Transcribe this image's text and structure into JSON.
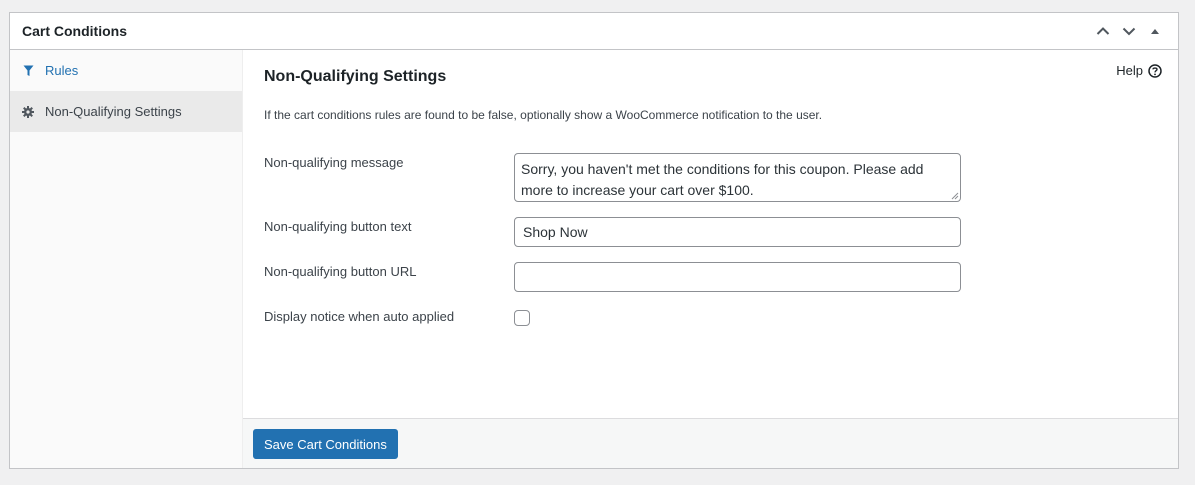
{
  "metabox": {
    "title": "Cart Conditions",
    "actions": [
      {
        "name": "move-up-button",
        "icon": "chevron-up-icon"
      },
      {
        "name": "move-down-button",
        "icon": "chevron-down-icon"
      },
      {
        "name": "toggle-panel-button",
        "icon": "triangle-up-icon"
      }
    ]
  },
  "tabs": [
    {
      "label": "Rules",
      "icon": "filter-icon",
      "active": false
    },
    {
      "label": "Non-Qualifying Settings",
      "icon": "gear-icon",
      "active": true
    }
  ],
  "panel": {
    "title": "Non-Qualifying Settings",
    "help_label": "Help",
    "description": "If the cart conditions rules are found to be false, optionally show a WooCommerce notification to the user.",
    "fields": {
      "message": {
        "label": "Non-qualifying message",
        "value": "Sorry, you haven't met the conditions for this coupon. Please add more to increase your cart over $100."
      },
      "button_text": {
        "label": "Non-qualifying button text",
        "value": "Shop Now"
      },
      "button_url": {
        "label": "Non-qualifying button URL",
        "value": ""
      },
      "display_notice": {
        "label": "Display notice when auto applied",
        "checked": false
      }
    }
  },
  "footer": {
    "save_label": "Save Cart Conditions"
  },
  "colors": {
    "primary": "#2271b1",
    "link": "#2271b1",
    "border": "#c3c4c7"
  }
}
